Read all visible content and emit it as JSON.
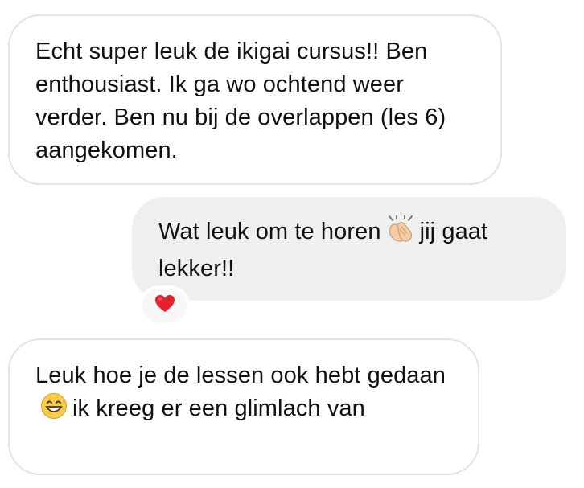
{
  "messages": [
    {
      "direction": "incoming",
      "text": "Echt super leuk de ikigai cursus!! Ben enthousiast. Ik ga wo ochtend weer verder. Ben nu bij de overlappen (les 6) aangekomen."
    },
    {
      "direction": "outgoing",
      "text_before_emoji": "Wat leuk om te horen",
      "emoji": "clapping-hands-icon",
      "text_after_emoji": "jij gaat lekker!!",
      "reaction": "red-heart-icon"
    },
    {
      "direction": "incoming",
      "text_before_emoji": "Leuk hoe je de lessen ook hebt gedaan",
      "emoji": "grinning-face-icon",
      "text_after_emoji": "ik kreeg er een glimlach van"
    }
  ],
  "colors": {
    "incoming_bubble_bg": "#ffffff",
    "incoming_bubble_border": "#e3e3e3",
    "outgoing_bubble_bg": "#efefef",
    "text": "#111111",
    "heart": "#e8202e"
  }
}
